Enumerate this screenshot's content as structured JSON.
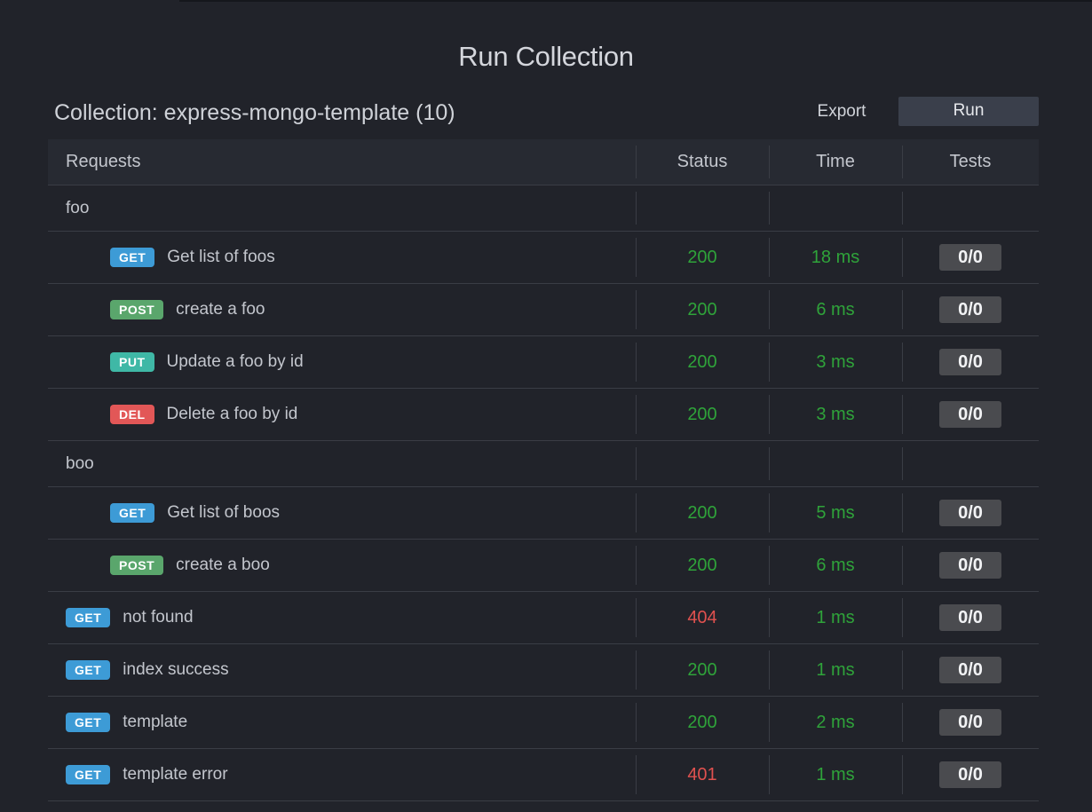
{
  "title": "Run Collection",
  "collection": {
    "name": "Collection: express-mongo-template (10)",
    "export_label": "Export",
    "run_label": "Run"
  },
  "table": {
    "headers": {
      "requests": "Requests",
      "status": "Status",
      "time": "Time",
      "tests": "Tests"
    },
    "rows": [
      {
        "kind": "group",
        "label": "foo"
      },
      {
        "kind": "request",
        "indented": true,
        "method": "GET",
        "label": "Get list of foos",
        "status": "200",
        "status_ok": true,
        "time": "18 ms",
        "tests": "0/0"
      },
      {
        "kind": "request",
        "indented": true,
        "method": "POST",
        "label": "create a foo",
        "status": "200",
        "status_ok": true,
        "time": "6 ms",
        "tests": "0/0"
      },
      {
        "kind": "request",
        "indented": true,
        "method": "PUT",
        "label": "Update a foo by id",
        "status": "200",
        "status_ok": true,
        "time": "3 ms",
        "tests": "0/0"
      },
      {
        "kind": "request",
        "indented": true,
        "method": "DEL",
        "label": "Delete a foo by id",
        "status": "200",
        "status_ok": true,
        "time": "3 ms",
        "tests": "0/0"
      },
      {
        "kind": "group",
        "label": "boo"
      },
      {
        "kind": "request",
        "indented": true,
        "method": "GET",
        "label": "Get list of boos",
        "status": "200",
        "status_ok": true,
        "time": "5 ms",
        "tests": "0/0"
      },
      {
        "kind": "request",
        "indented": true,
        "method": "POST",
        "label": "create a boo",
        "status": "200",
        "status_ok": true,
        "time": "6 ms",
        "tests": "0/0"
      },
      {
        "kind": "request",
        "indented": false,
        "method": "GET",
        "label": "not found",
        "status": "404",
        "status_ok": false,
        "time": "1 ms",
        "tests": "0/0"
      },
      {
        "kind": "request",
        "indented": false,
        "method": "GET",
        "label": "index success",
        "status": "200",
        "status_ok": true,
        "time": "1 ms",
        "tests": "0/0"
      },
      {
        "kind": "request",
        "indented": false,
        "method": "GET",
        "label": "template",
        "status": "200",
        "status_ok": true,
        "time": "2 ms",
        "tests": "0/0"
      },
      {
        "kind": "request",
        "indented": false,
        "method": "GET",
        "label": "template error",
        "status": "401",
        "status_ok": false,
        "time": "1 ms",
        "tests": "0/0"
      }
    ]
  },
  "colors": {
    "background": "#21232a",
    "method_get": "#3d9bd6",
    "method_post": "#5aa66c",
    "method_put": "#3fb8a6",
    "method_del": "#e25757",
    "status_ok": "#2fa33a",
    "status_error": "#e0514f",
    "time": "#2fa33a",
    "run_button": "#3a3f4b",
    "tests_badge": "#4a4b4f"
  }
}
